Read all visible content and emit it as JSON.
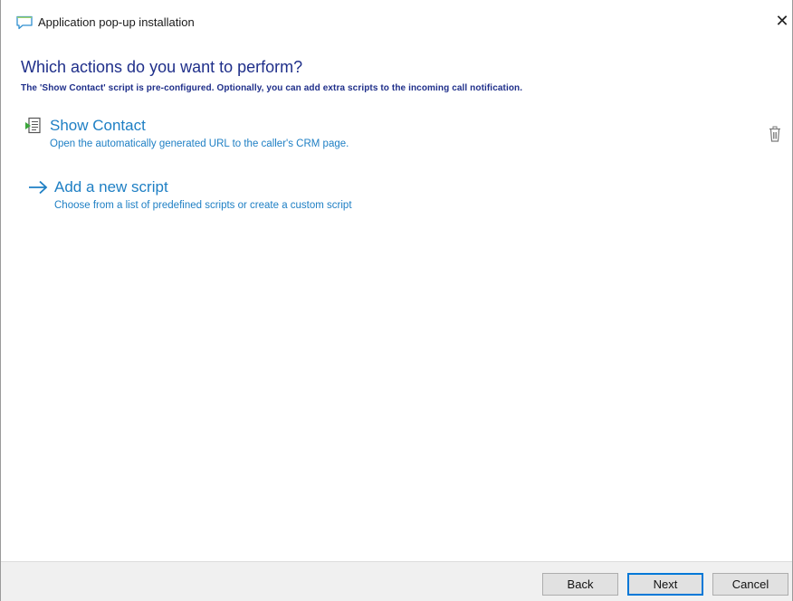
{
  "window": {
    "title": "Application pop-up installation",
    "close_glyph": "✕",
    "title_icon": "chat-bubble-icon"
  },
  "main": {
    "heading": "Which actions do you want to perform?",
    "subheading": "The 'Show Contact' script is pre-configured. Optionally, you can add extra scripts to the incoming call notification.",
    "actions": [
      {
        "title": "Show Contact",
        "description": "Open the automatically generated URL to the caller's CRM page.",
        "icon": "script-icon",
        "delete_icon": "trash-icon"
      }
    ],
    "add_script": {
      "title": "Add a new script",
      "description": "Choose from a list of predefined scripts or create a custom script",
      "icon": "arrow-right-icon"
    }
  },
  "footer": {
    "back_label": "Back",
    "next_label": "Next",
    "cancel_label": "Cancel"
  },
  "colors": {
    "heading": "#1f2f8a",
    "link": "#1e7fc4",
    "footer_bg": "#f0f0f0",
    "default_button_border": "#0078d7"
  }
}
